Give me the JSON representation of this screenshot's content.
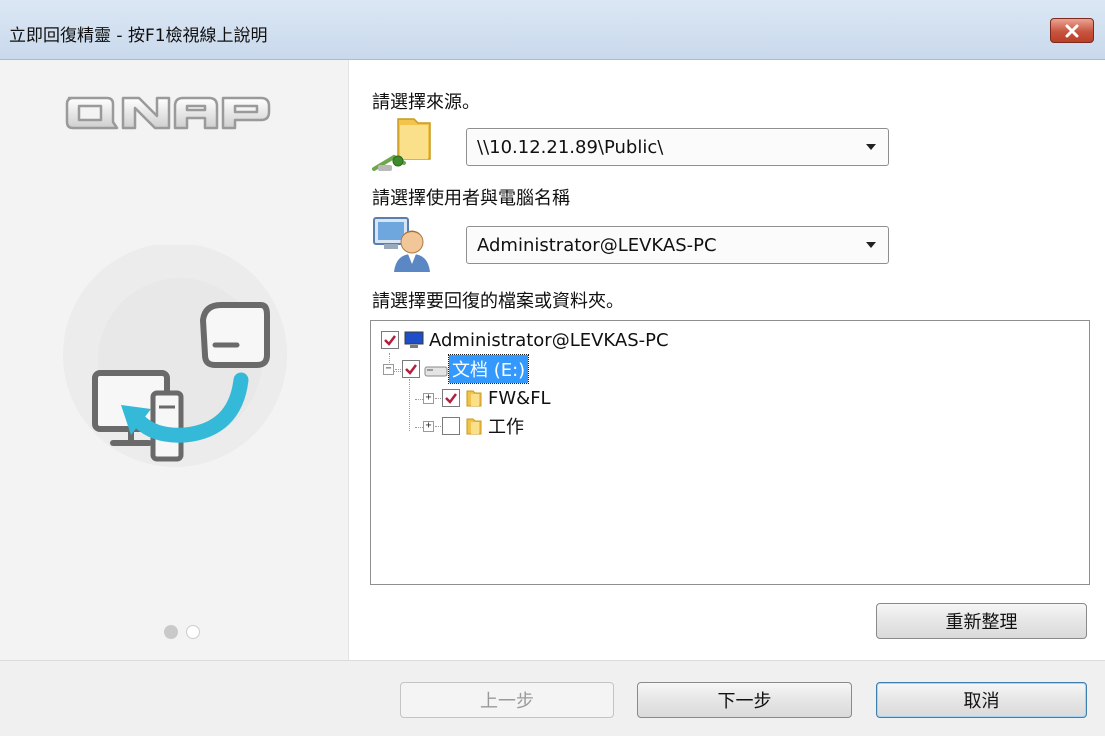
{
  "window": {
    "title": "立即回復精靈 - 按F1檢視線上說明"
  },
  "branding": {
    "logo_text": "QNAP",
    "page_indicator": {
      "current": 1,
      "total": 2
    }
  },
  "source": {
    "label": "請選擇來源。",
    "selected": "\\\\10.12.21.89\\Public\\"
  },
  "user": {
    "label": "請選擇使用者與電腦名稱",
    "selected": "Administrator@LEVKAS-PC"
  },
  "tree": {
    "label": "請選擇要回復的檔案或資料夾。",
    "root": {
      "label": "Administrator@LEVKAS-PC",
      "checked": true
    },
    "drive": {
      "label": "文档 (E:)",
      "checked": true,
      "selected": true
    },
    "folders": [
      {
        "label": "FW&FL",
        "checked": true
      },
      {
        "label": "工作",
        "checked": false
      }
    ]
  },
  "buttons": {
    "refresh": "重新整理",
    "back": "上一步",
    "next": "下一步",
    "cancel": "取消"
  },
  "colors": {
    "selection": "#3399ff",
    "check": "#b0203c",
    "accent_arrow": "#35b9d9"
  }
}
